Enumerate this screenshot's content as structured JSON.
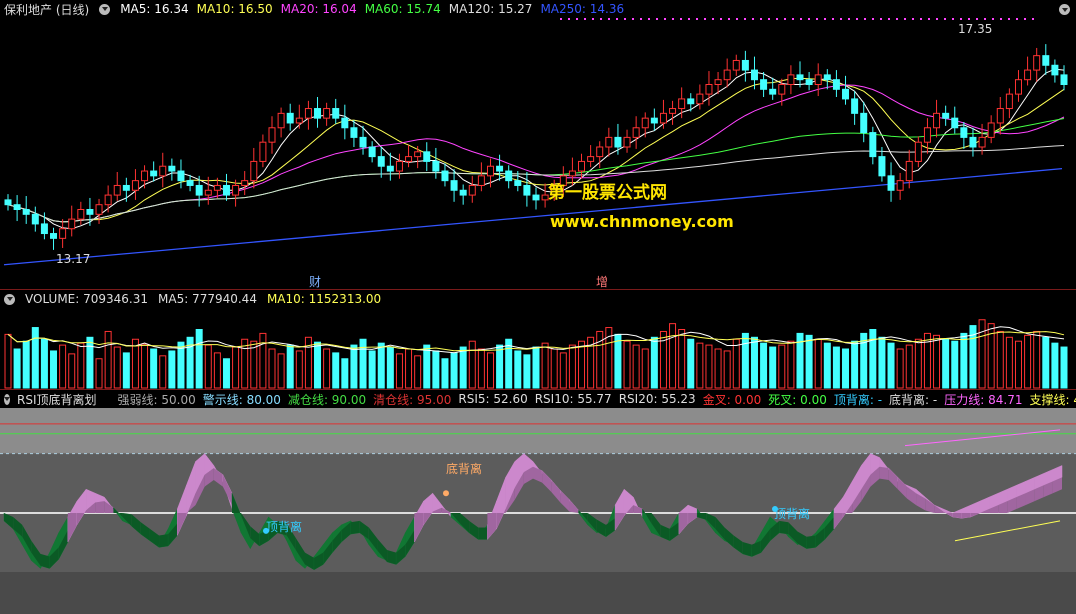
{
  "price": {
    "title": "保利地产 (日线)",
    "ma": [
      {
        "label": "MA5: 16.34",
        "color": "#ffffff"
      },
      {
        "label": "MA10: 16.50",
        "color": "#ffff55"
      },
      {
        "label": "MA20: 16.04",
        "color": "#ff44ff"
      },
      {
        "label": "MA60: 15.74",
        "color": "#44ff44"
      },
      {
        "label": "MA120: 15.27",
        "color": "#dddddd"
      },
      {
        "label": "MA250: 14.36",
        "color": "#3355ff"
      }
    ],
    "high_label": "17.35",
    "low_label": "13.17",
    "event1": "财",
    "event2": "增",
    "watermark1": "第一股票公式网",
    "watermark2": "www.chnmoney.com"
  },
  "volume": {
    "labels": [
      {
        "label": "VOLUME: 709346.31",
        "color": "#dddddd"
      },
      {
        "label": "MA5: 777940.44",
        "color": "#dddddd"
      },
      {
        "label": "MA10: 1152313.00",
        "color": "#ffff55"
      }
    ]
  },
  "rsi": {
    "title": "RSI顶底背离划",
    "items": [
      {
        "label": "强弱线: 50.00",
        "color": "#aaaaaa"
      },
      {
        "label": "警示线: 80.00",
        "color": "#88ddff"
      },
      {
        "label": "减仓线: 90.00",
        "color": "#44dd44"
      },
      {
        "label": "清仓线: 95.00",
        "color": "#dd3333"
      },
      {
        "label": "RSI5: 52.60",
        "color": "#dddddd"
      },
      {
        "label": "RSI10: 55.77",
        "color": "#dddddd"
      },
      {
        "label": "RSI20: 55.23",
        "color": "#dddddd"
      },
      {
        "label": "金叉: 0.00",
        "color": "#ff3333"
      },
      {
        "label": "死叉: 0.00",
        "color": "#44ff44"
      },
      {
        "label": "顶背离: -",
        "color": "#33ccff"
      },
      {
        "label": "底背离: -",
        "color": "#dddddd"
      },
      {
        "label": "压力线: 84.71",
        "color": "#ff66ff"
      },
      {
        "label": "支撑线: 45.50",
        "color": "#ffff55"
      }
    ],
    "div_bottom": "底背离",
    "div_top1": "顶背离",
    "div_top2": "顶背离"
  },
  "chart_data": [
    {
      "type": "candlestick",
      "title": "保利地产 (日线)",
      "ylim": [
        12.6,
        17.8
      ],
      "close": [
        14.0,
        13.9,
        13.8,
        13.6,
        13.4,
        13.3,
        13.5,
        13.7,
        13.9,
        13.8,
        14.0,
        14.2,
        14.4,
        14.3,
        14.5,
        14.7,
        14.6,
        14.8,
        14.7,
        14.5,
        14.4,
        14.2,
        14.3,
        14.4,
        14.2,
        14.4,
        14.5,
        14.9,
        15.3,
        15.6,
        15.9,
        15.7,
        15.8,
        16.0,
        15.8,
        16.0,
        15.8,
        15.6,
        15.4,
        15.2,
        15.0,
        14.8,
        14.7,
        14.9,
        15.0,
        15.1,
        14.9,
        14.7,
        14.5,
        14.3,
        14.2,
        14.4,
        14.6,
        14.8,
        14.7,
        14.5,
        14.4,
        14.2,
        14.1,
        14.2,
        14.4,
        14.6,
        14.7,
        14.9,
        15.0,
        15.2,
        15.4,
        15.2,
        15.4,
        15.6,
        15.8,
        15.7,
        15.9,
        16.0,
        16.2,
        16.1,
        16.3,
        16.5,
        16.6,
        16.8,
        17.0,
        16.8,
        16.6,
        16.4,
        16.3,
        16.5,
        16.7,
        16.6,
        16.5,
        16.7,
        16.6,
        16.4,
        16.2,
        15.9,
        15.5,
        15.0,
        14.6,
        14.3,
        14.5,
        14.9,
        15.3,
        15.6,
        15.9,
        15.8,
        15.6,
        15.4,
        15.2,
        15.4,
        15.7,
        16.0,
        16.3,
        16.6,
        16.8,
        17.1,
        16.9,
        16.7,
        16.5
      ],
      "ma_values": {
        "MA5": 16.34,
        "MA10": 16.5,
        "MA20": 16.04,
        "MA60": 15.74,
        "MA120": 15.27,
        "MA250": 14.36
      },
      "annotations": [
        "17.35",
        "13.17"
      ]
    },
    {
      "type": "bar",
      "title": "VOLUME",
      "values": [
        55,
        40,
        48,
        62,
        50,
        38,
        44,
        35,
        46,
        52,
        30,
        58,
        42,
        36,
        50,
        45,
        40,
        33,
        38,
        47,
        52,
        60,
        44,
        36,
        30,
        42,
        50,
        48,
        56,
        40,
        35,
        44,
        38,
        52,
        47,
        40,
        36,
        30,
        44,
        50,
        38,
        46,
        42,
        35,
        40,
        33,
        44,
        38,
        30,
        36,
        42,
        48,
        40,
        36,
        44,
        50,
        38,
        34,
        42,
        46,
        40,
        36,
        44,
        48,
        52,
        58,
        62,
        55,
        48,
        44,
        40,
        52,
        58,
        66,
        60,
        50,
        46,
        44,
        40,
        38,
        50,
        56,
        52,
        46,
        42,
        44,
        48,
        56,
        54,
        50,
        46,
        42,
        40,
        48,
        56,
        60,
        52,
        46,
        40,
        44,
        50,
        56,
        54,
        50,
        48,
        56,
        64,
        70,
        66,
        58,
        52,
        48,
        54,
        58,
        52,
        46,
        42
      ]
    },
    {
      "type": "area",
      "title": "RSI顶底背离划",
      "ylim": [
        0,
        100
      ],
      "rsi5": [
        50,
        42,
        34,
        26,
        22,
        30,
        40,
        48,
        56,
        62,
        60,
        58,
        52,
        46,
        44,
        40,
        36,
        34,
        42,
        52,
        64,
        76,
        80,
        74,
        66,
        52,
        40,
        32,
        40,
        48,
        44,
        36,
        26,
        22,
        28,
        34,
        40,
        44,
        46,
        42,
        34,
        28,
        26,
        30,
        40,
        48,
        56,
        60,
        54,
        48,
        44,
        40,
        38,
        44,
        56,
        68,
        76,
        80,
        76,
        70,
        66,
        60,
        56,
        50,
        44,
        40,
        42,
        54,
        62,
        58,
        48,
        40,
        38,
        42,
        50,
        54,
        52,
        46,
        40,
        36,
        34,
        30,
        32,
        40,
        48,
        44,
        38,
        34,
        36,
        40,
        46,
        52,
        58,
        66,
        74,
        80,
        78,
        72,
        66,
        64,
        62,
        58,
        54,
        52,
        50,
        52,
        54,
        56,
        58,
        60,
        62,
        64,
        66,
        68,
        70,
        72,
        74
      ]
    }
  ]
}
